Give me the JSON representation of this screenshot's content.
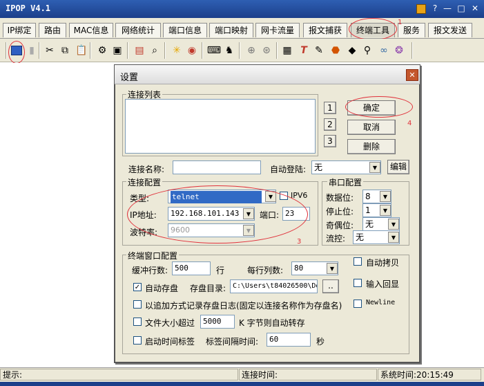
{
  "app_title": "IPOP V4.1",
  "window_controls": {
    "minimize": "—",
    "restore": "□",
    "close": "✕",
    "help": "?"
  },
  "tabs": [
    "IP绑定",
    "路由",
    "MAC信息",
    "网络统计",
    "端口信息",
    "端口映射",
    "网卡流量",
    "报文捕获",
    "终端工具",
    "服务",
    "报文发送"
  ],
  "active_tab": "终端工具",
  "toolbar_icons": [
    "connect-icon",
    "disconnect-icon",
    "cut-icon",
    "copy-icon",
    "paste-icon",
    "settings-icon",
    "print-icon",
    "save-icon",
    "find-icon",
    "light-icon",
    "record-icon",
    "keyboard-icon",
    "macro-icon",
    "zoom-in-icon",
    "target-icon",
    "grid-icon",
    "text-icon",
    "edit-icon",
    "stop-icon",
    "tag-icon",
    "zoom-icon",
    "link-icon",
    "help-icon"
  ],
  "annotations": {
    "n1": "1",
    "n2": "2",
    "n3": "3",
    "n4": "4"
  },
  "dialog": {
    "title": "设置",
    "connection_list_label": "连接列表",
    "side_buttons": [
      "1",
      "2",
      "3"
    ],
    "ok_label": "确定",
    "cancel_label": "取消",
    "delete_label": "删除",
    "conn_name_label": "连接名称:",
    "conn_name_value": "",
    "auto_login_label": "自动登陆:",
    "auto_login_value": "无",
    "edit_label": "编辑",
    "conn_config_label": "连接配置",
    "type_label": "类型:",
    "type_value": "telnet",
    "ipv6_label": "IPV6",
    "ip_label": "IP地址:",
    "ip_value": "192.168.101.143",
    "port_label": "端口:",
    "port_value": "23",
    "baud_label": "波特率:",
    "baud_value": "9600",
    "serial_label": "串口配置",
    "data_bits_label": "数据位:",
    "data_bits_value": "8",
    "stop_bits_label": "停止位:",
    "stop_bits_value": "1",
    "parity_label": "奇偶位:",
    "parity_value": "无",
    "flow_label": "流控:",
    "flow_value": "无",
    "term_label": "终端窗口配置",
    "buffer_label": "缓冲行数:",
    "buffer_value": "500",
    "buffer_unit": "行",
    "cols_label": "每行列数:",
    "cols_value": "80",
    "auto_copy_label": "自动拷贝",
    "auto_save_label": "自动存盘",
    "save_dir_label": "存盘目录:",
    "save_dir_value": "C:\\Users\\t84026500\\Do",
    "browse_label": "..",
    "echo_label": "输入回显",
    "append_label": "以追加方式记录存盘日志(固定以连接名称作为存盘名)",
    "newline_label": "Newline",
    "size_label": "文件大小超过",
    "size_value": "5000",
    "size_suffix": "K 字节则自动转存",
    "timestamp_label": "启动时间标签",
    "interval_label": "标签间隔时间:",
    "interval_value": "60",
    "interval_unit": "秒"
  },
  "status": {
    "hint_label": "提示:",
    "conn_time_label": "连接时间:",
    "sys_time_label": "系统时间:",
    "sys_time_value": "20:15:49"
  }
}
